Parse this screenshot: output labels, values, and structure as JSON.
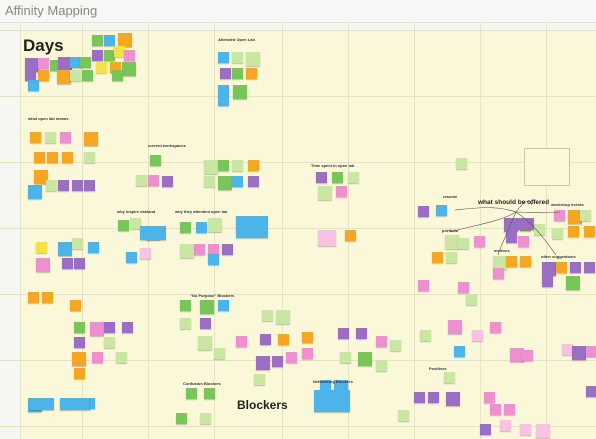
{
  "app": {
    "title": "Affinity Mapping"
  },
  "headings": {
    "days": "Days",
    "blockers": "Blockers",
    "what_should_be_offered": "what should be offered",
    "attended_open_lab": "Attended Open Lab",
    "what_open_lab_means": "what open lab means",
    "current_workspaces": "current workspaces",
    "why_inspire_oakland": "why inspire oakland",
    "why_they_attended_open_lab": "why they attended open lab",
    "time_spent_in_open_lab": "Time spent in open lab",
    "no_purpose_blockers": "\"No Purpose\" Blockers",
    "confusion_blockers": "Confusion Blockers",
    "networking_blockers": "Networking Blockers",
    "resume": "resume",
    "portfolio": "portfolio",
    "mentors": "mentors",
    "workshop_events": "workshop events",
    "other_suggestions": "other suggestions",
    "positives": "Positives"
  },
  "colors": {
    "green": "#78c65a",
    "pink": "#ee8fd0",
    "blue": "#4cb4e8",
    "purple": "#9a6fc3",
    "orange": "#f5a623",
    "yellow": "#f6e14b",
    "lightgreen": "#c9e7a2",
    "lightpink": "#f8c3e2",
    "red": "#f05b5b",
    "board_bg": "#fbf8d9"
  }
}
